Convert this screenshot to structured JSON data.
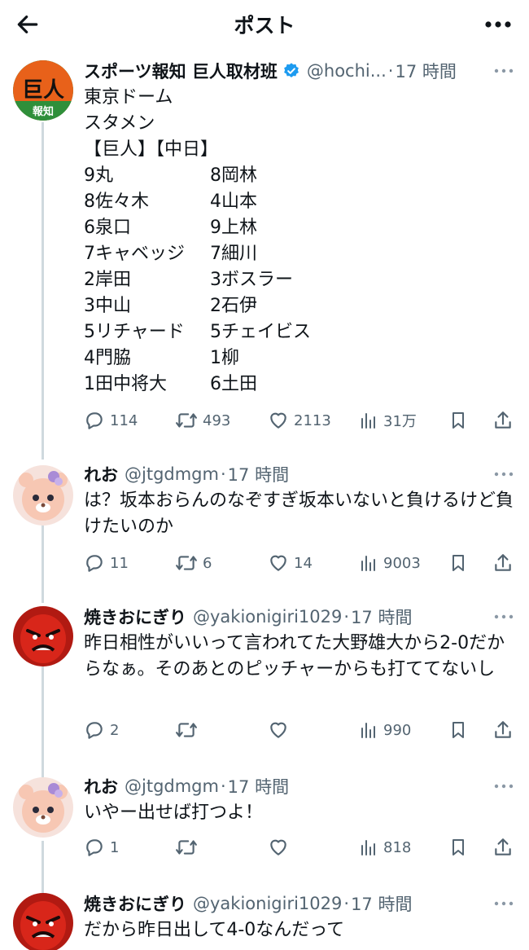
{
  "header": {
    "title": "ポスト",
    "back_icon": "arrow-left-icon",
    "more_icon": "more-icon"
  },
  "main_tweet": {
    "name": "スポーツ報知 巨人取材班",
    "handle": "@hochi...",
    "dot": "·",
    "time": "17 時間",
    "avatar_text": "巨人",
    "avatar_sub": "報知",
    "lines": [
      "東京ドーム",
      "スタメン"
    ],
    "lineup_header": "【巨人】【中日】",
    "lineup": [
      {
        "left": "9丸",
        "right": "8岡林"
      },
      {
        "left": "8佐々木",
        "right": "4山本"
      },
      {
        "left": "6泉口",
        "right": "9上林"
      },
      {
        "left": "7キャベッジ",
        "right": "7細川"
      },
      {
        "left": "2岸田",
        "right": "3ボスラー"
      },
      {
        "left": "3中山",
        "right": "2石伊"
      },
      {
        "left": "5リチャード",
        "right": "5チェイビス"
      },
      {
        "left": "4門脇",
        "right": "1柳"
      },
      {
        "left": "1田中将大",
        "right": "6土田"
      }
    ],
    "replies": "114",
    "retweets": "493",
    "likes": "2113",
    "views": "31万"
  },
  "replies": [
    {
      "name": "れお",
      "handle": "@jtgdmgm",
      "dot": "·",
      "time": "17 時間",
      "text": "は？坂本おらんのなぞすぎ坂本いないと負けるけど負けたいのか",
      "replies": "11",
      "retweets": "6",
      "likes": "14",
      "views": "9003"
    },
    {
      "name": "焼きおにぎり",
      "handle": "@yakionigiri1029",
      "dot": "·",
      "time": "17 時間",
      "text": "昨日相性がいいって言われてた大野雄大から2-0だからなぁ。そのあとのピッチャーからも打ててないし",
      "replies": "2",
      "retweets": "",
      "likes": "",
      "views": "990"
    },
    {
      "name": "れお",
      "handle": "@jtgdmgm",
      "dot": "·",
      "time": "17 時間",
      "text": "いやー出せば打つよ！",
      "replies": "1",
      "retweets": "",
      "likes": "",
      "views": "818"
    },
    {
      "name": "焼きおにぎり",
      "handle": "@yakionigiri1029",
      "dot": "·",
      "time": "17 時間",
      "text": "だから昨日出して4-0なんだって"
    }
  ],
  "colors": {
    "verified": "#1d9bf0",
    "muted": "#536471",
    "thread_line": "#cfd9de"
  }
}
